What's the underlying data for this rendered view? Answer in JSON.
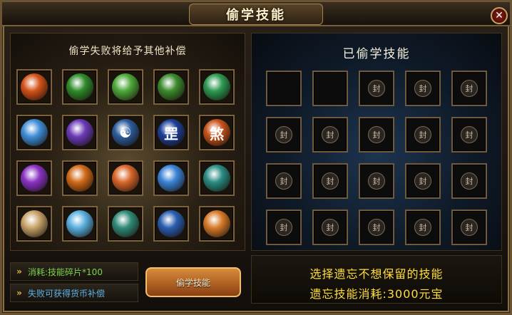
{
  "window": {
    "title": "偷学技能",
    "close_label": "✕"
  },
  "left": {
    "heading": "偷学失败将给予其他补偿",
    "skills": [
      {
        "name": "fire-slash",
        "glyph": "",
        "color": "#d4531a"
      },
      {
        "name": "green-spirit",
        "glyph": "",
        "color": "#2f8c2c"
      },
      {
        "name": "green-whirl",
        "glyph": "",
        "color": "#4ea83a"
      },
      {
        "name": "green-orb",
        "glyph": "",
        "color": "#3c8a2f"
      },
      {
        "name": "green-swirl",
        "glyph": "",
        "color": "#2d9a52"
      },
      {
        "name": "ice-slash",
        "glyph": "",
        "color": "#3f8ed8"
      },
      {
        "name": "purple-hands",
        "glyph": "",
        "color": "#6b3ab8"
      },
      {
        "name": "taiji",
        "glyph": "☯",
        "color": "#2c5c9c"
      },
      {
        "name": "blue-rune",
        "glyph": "罡",
        "color": "#1d3f9a"
      },
      {
        "name": "fire-rune",
        "glyph": "煞",
        "color": "#c6541c"
      },
      {
        "name": "purple-flower",
        "glyph": "",
        "color": "#8a32c4"
      },
      {
        "name": "fire-ring",
        "glyph": "",
        "color": "#d16a18"
      },
      {
        "name": "fire-heart",
        "glyph": "",
        "color": "#d9662b"
      },
      {
        "name": "ice-strike",
        "glyph": "",
        "color": "#3a84d6"
      },
      {
        "name": "teal-claw",
        "glyph": "",
        "color": "#2a8c84"
      },
      {
        "name": "skeleton",
        "glyph": "",
        "color": "#c8a36a"
      },
      {
        "name": "ice-wave",
        "glyph": "",
        "color": "#5ab0e0"
      },
      {
        "name": "green-blade",
        "glyph": "",
        "color": "#2f8a78"
      },
      {
        "name": "blue-eye",
        "glyph": "",
        "color": "#2a5cb0"
      },
      {
        "name": "fire-meteor",
        "glyph": "",
        "color": "#d77a2a"
      }
    ],
    "cost_label": "消耗:技能碎片*100",
    "compensation_label": "失败可获得货币补偿",
    "steal_button": "偷学技能"
  },
  "right": {
    "heading": "已偷学技能",
    "lock_glyph": "封",
    "empty_slots": 2,
    "total_slots": 20,
    "forget_hint": "选择遗忘不想保留的技能",
    "forget_cost": "遗忘技能消耗:3000元宝"
  },
  "colors": {
    "gold": "#ffde3b",
    "cost_green": "#7fd24a",
    "info_blue": "#5bb3e6"
  }
}
